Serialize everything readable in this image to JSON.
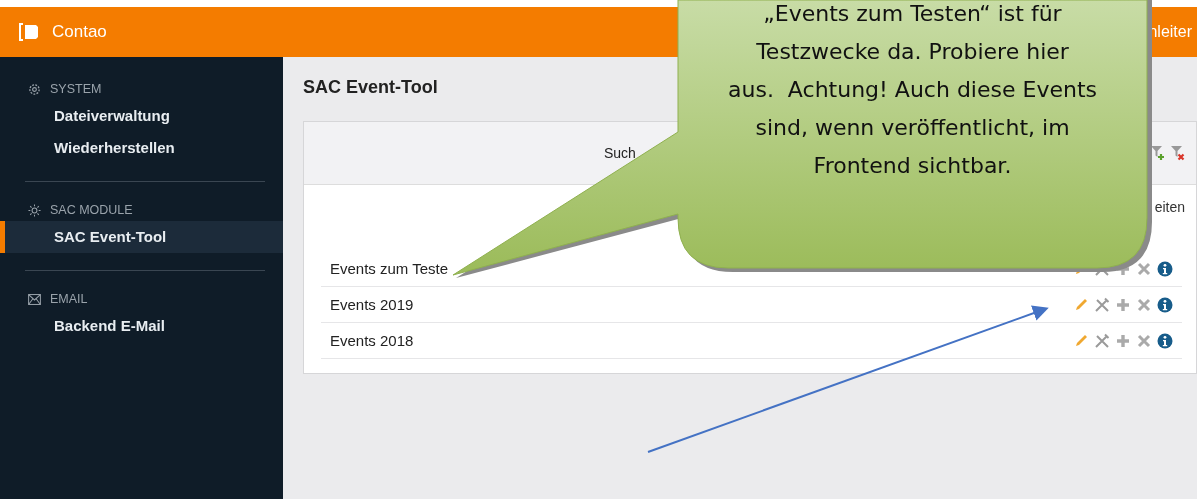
{
  "header": {
    "logo": "Contao",
    "right_text": "nleiter"
  },
  "sidebar": {
    "groups": [
      {
        "kind": "gear",
        "title": "SYSTEM",
        "items": [
          {
            "label": "Dateiverwaltung",
            "selected": false
          },
          {
            "label": "Wiederherstellen",
            "selected": false
          }
        ]
      },
      {
        "kind": "sun",
        "title": "SAC MODULE",
        "items": [
          {
            "label": "SAC Event-Tool",
            "selected": true
          }
        ]
      },
      {
        "kind": "mail",
        "title": "EMAIL",
        "items": [
          {
            "label": "Backend E-Mail",
            "selected": false
          }
        ]
      }
    ]
  },
  "page_title": "SAC Event-Tool",
  "panel": {
    "search_label": "Such",
    "column_hint": "eiten",
    "rows": [
      {
        "label": "Events zum Teste"
      },
      {
        "label": "Events 2019"
      },
      {
        "label": "Events 2018"
      }
    ]
  },
  "callout": {
    "lines": [
      "„Events zum Testen“ ist für",
      "Testzwecke da. Probiere hier",
      "aus.  Achtung! Auch diese Events",
      "sind, wenn veröffentlicht, im",
      "Frontend sichtbar."
    ]
  }
}
